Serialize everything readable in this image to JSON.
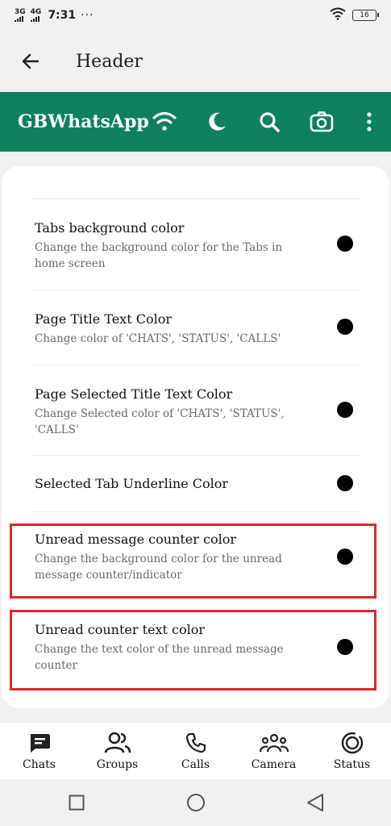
{
  "status_bar": {
    "network1": "3G",
    "network2": "4G",
    "time": "7:31",
    "more": "···",
    "battery": "16"
  },
  "header": {
    "title": "Header"
  },
  "app_bar": {
    "name": "GBWhatsApp",
    "icons": [
      "wifi-icon",
      "moon-icon",
      "search-icon",
      "camera-icon",
      "more-vertical-icon"
    ]
  },
  "settings": {
    "items": [
      {
        "title": "Tabs background color",
        "description": "Change the background color for the Tabs in home screen",
        "color": "#000000"
      },
      {
        "title": "Page Title Text Color",
        "description": "Change color of 'CHATS', 'STATUS', 'CALLS'",
        "color": "#000000"
      },
      {
        "title": "Page Selected Title Text Color",
        "description": "Change Selected color of 'CHATS', 'STATUS', 'CALLS'",
        "color": "#000000"
      },
      {
        "title": "Selected Tab Underline Color",
        "description": "",
        "color": "#000000"
      },
      {
        "title": "Unread message counter color",
        "description": "Change the background color for the unread message counter/indicator",
        "color": "#000000",
        "highlighted": true
      },
      {
        "title": "Unread counter text color",
        "description": "Change the text color of the unread message counter",
        "color": "#000000",
        "highlighted": true
      }
    ]
  },
  "bottom_nav": {
    "items": [
      {
        "label": "Chats",
        "icon": "chat-icon"
      },
      {
        "label": "Groups",
        "icon": "groups-icon"
      },
      {
        "label": "Calls",
        "icon": "phone-icon"
      },
      {
        "label": "Camera",
        "icon": "community-icon"
      },
      {
        "label": "Status",
        "icon": "status-icon"
      }
    ]
  },
  "colors": {
    "app_bar": "#0e8060",
    "highlight": "#e0262e"
  }
}
